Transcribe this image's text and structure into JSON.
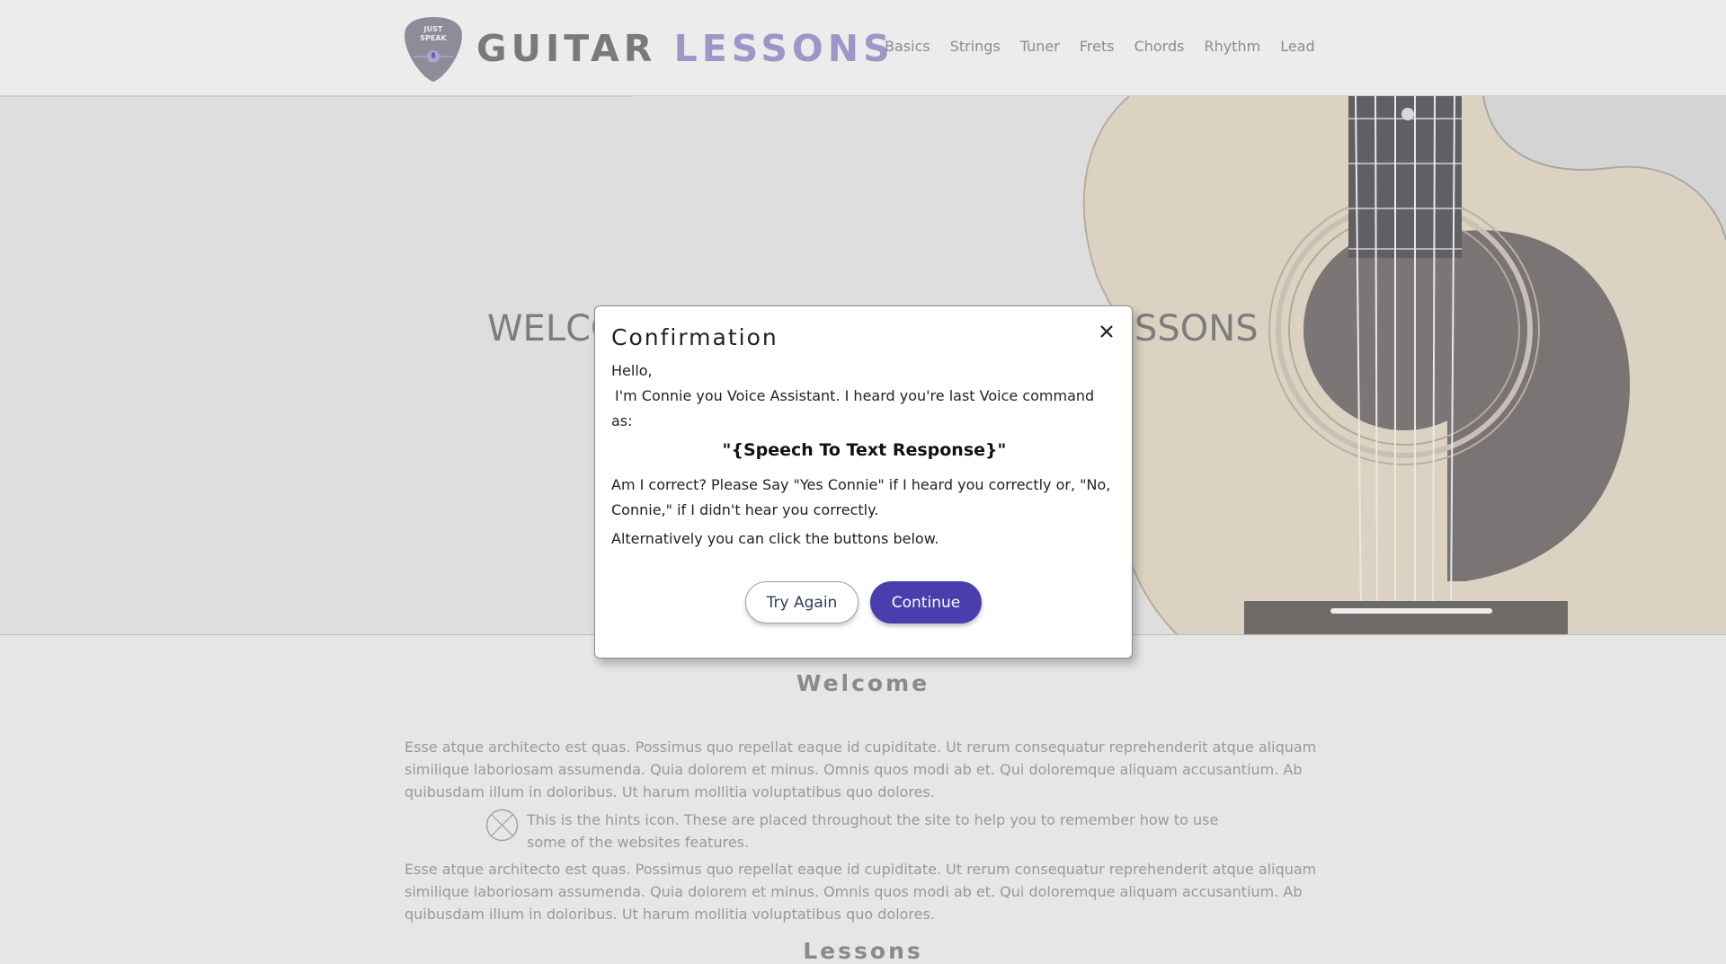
{
  "header": {
    "logo_text_line1": "JUST",
    "logo_text_line2": "SPEAK",
    "brand_part1": "GUITAR",
    "brand_part2": "LESSONS",
    "nav": [
      "Basics",
      "Strings",
      "Tuner",
      "Frets",
      "Chords",
      "Rhythm",
      "Lead"
    ]
  },
  "hero": {
    "title_left_visible": "WELCO",
    "title_right_visible": "SSONS"
  },
  "content": {
    "welcome_title": "Welcome",
    "paragraph1": "Esse atque architecto est quas. Possimus quo repellat eaque id cupiditate. Ut rerum consequatur reprehenderit atque aliquam similique laboriosam assumenda. Quia dolorem et minus. Omnis quos modi ab et. Qui doloremque aliquam accusantium. Ab quibusdam illum in doloribus. Ut harum mollitia voluptatibus quo dolores.",
    "hint_text": "This is the hints icon. These are placed throughout the site to help you to remember how to use some of the websites features.",
    "paragraph2": "Esse atque architecto est quas. Possimus quo repellat eaque id cupiditate. Ut rerum consequatur reprehenderit atque aliquam similique laboriosam assumenda. Quia dolorem et minus. Omnis quos modi ab et. Qui doloremque aliquam accusantium. Ab quibusdam illum in doloribus. Ut harum mollitia voluptatibus quo dolores.",
    "lessons_title": "Lessons"
  },
  "modal": {
    "title": "Confirmation",
    "greeting": "Hello,",
    "intro": "I'm Connie you Voice Assistant. I heard you're last Voice command as:",
    "quote": "\"{Speech To Text Response}\"",
    "question": "Am I correct? Please Say \"Yes Connie\" if I heard you correctly or, \"No, Connie,\" if I didn't hear you correctly.",
    "alternative": "Alternatively you can click the buttons below.",
    "try_again_label": "Try Again",
    "continue_label": "Continue"
  },
  "colors": {
    "accent": "#4a3dae",
    "brand_lavender": "#9e96c6",
    "overlay_gray": "#e6e6e6"
  },
  "icons": {
    "close": "close-icon",
    "hint": "hint-icon",
    "logo": "guitar-pick-logo"
  }
}
